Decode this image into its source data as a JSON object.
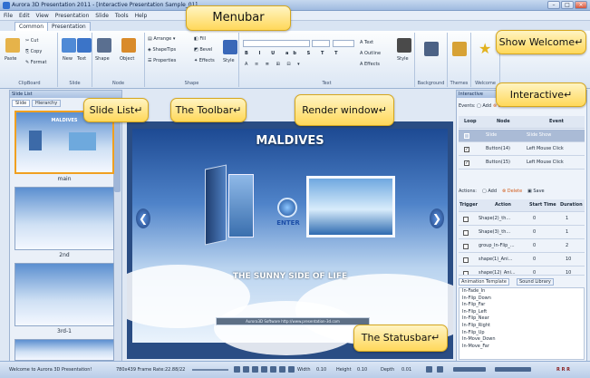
{
  "window": {
    "title": "Aurora 3D Presentation 2011 - [Interactive Presentation Sample_01]"
  },
  "menu": [
    "File",
    "Edit",
    "View",
    "Presentation",
    "Slide",
    "Tools",
    "Help"
  ],
  "tabs": [
    "Common",
    "Presentation"
  ],
  "ribbon": {
    "clipboard": {
      "label": "ClipBoard",
      "paste": "Paste",
      "cut": "Cut",
      "copy": "Copy",
      "format": "Format"
    },
    "slide": {
      "label": "Slide",
      "new": "New",
      "text": "Text"
    },
    "node": {
      "label": "Node",
      "shape": "Shape",
      "object": "Object"
    },
    "shape": {
      "label": "Shape",
      "arrange": "Arrange",
      "fill": "Fill",
      "shapetips": "ShapeTips",
      "bevel": "Bevel",
      "properties": "Properties",
      "effects": "Effects",
      "style": "Style"
    },
    "text": {
      "label": "Text",
      "text_btn": "Text",
      "outline": "Outline",
      "effects": "Effects",
      "style": "Style"
    },
    "background": {
      "label": "Background"
    },
    "themes": {
      "label": "Themes"
    },
    "welcome": {
      "label": "Welcome"
    }
  },
  "callouts": {
    "menubar": "Menubar",
    "show_welcome": "Show Welcome↵",
    "interactive": "Interactive↵",
    "slide_list": "Slide List↵",
    "toolbar": "The Toolbar↵",
    "render": "Render window↵",
    "statusbar": "The Statusbar↵"
  },
  "slide_list": {
    "title": "Slide List",
    "tabs": [
      "Slide",
      "Hierarchy"
    ],
    "slides": [
      {
        "caption": "main",
        "title": "MALDIVES"
      },
      {
        "caption": "2nd"
      },
      {
        "caption": "3rd-1"
      }
    ]
  },
  "render": {
    "slide_title": "MALDIVES",
    "enter": "ENTER",
    "tagline": "THE SUNNY SIDE OF LIFE",
    "footer": "Aurora3D Software  http://www.presentation-3d.com"
  },
  "interactive": {
    "title": "Interactive",
    "events_label": "Events:",
    "add": "Add",
    "delete": "Del",
    "headers": [
      "Loop",
      "Node",
      "Event"
    ],
    "rows": [
      {
        "checked": false,
        "node": "Slide",
        "event": "Slide Show"
      },
      {
        "checked": true,
        "node": "Button(14)",
        "event": "Left Mouse Click"
      },
      {
        "checked": true,
        "node": "Button(15)",
        "event": "Left Mouse Click"
      }
    ],
    "actions_label": "Actions:",
    "actions_add": "Add",
    "actions_delete": "Delete",
    "actions_save": "Save",
    "action_headers": [
      "Trigger",
      "Action",
      "Start Time",
      "Duration"
    ],
    "actions": [
      {
        "action": "Shape(2)_th...",
        "start": "0",
        "duration": "1"
      },
      {
        "action": "Shape(3)_th...",
        "start": "0",
        "duration": "1"
      },
      {
        "action": "group_In-Flip_...",
        "start": "0",
        "duration": "2"
      },
      {
        "action": "shape(1)_Ani...",
        "start": "0",
        "duration": "10"
      },
      {
        "action": "shape(12)_Ani...",
        "start": "0",
        "duration": "10"
      }
    ],
    "lib_tabs": [
      "Animation Template",
      "Sound Library"
    ],
    "animations": [
      "In-Fade_In",
      "In-Flip_Down",
      "In-Flip_Far",
      "In-Flip_Left",
      "In-Flip_Near",
      "In-Flip_Right",
      "In-Flip_Up",
      "In-Move_Down",
      "In-Move_Far"
    ]
  },
  "status": {
    "welcome": "Welcome to Aurora 3D Presentation!",
    "size": "780x439 Frame Rate:22.88/22",
    "width_label": "Width",
    "width_val": "0.10",
    "height_label": "Height",
    "height_val": "0.10",
    "depth_label": "Depth",
    "depth_val": "0.01",
    "right_btns": "R R R"
  }
}
